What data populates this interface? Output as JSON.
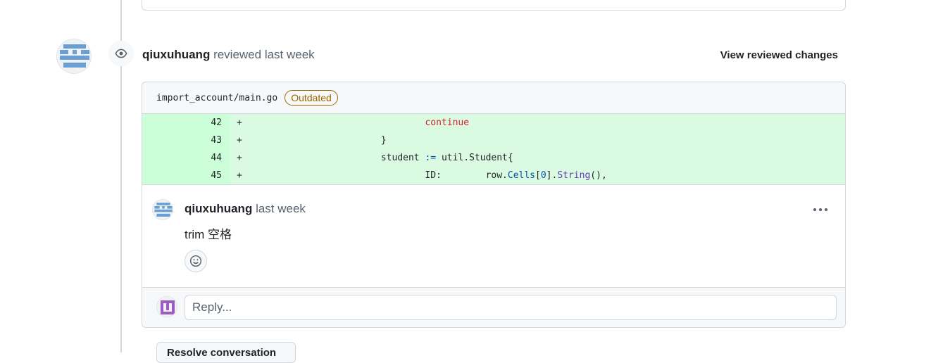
{
  "review": {
    "author": "qiuxuhuang",
    "action": "reviewed last week",
    "view_changes_label": "View reviewed changes"
  },
  "thread": {
    "file_path": "import_account/main.go",
    "badge": "Outdated",
    "diff_lines": [
      {
        "num": "42",
        "sign": "+"
      },
      {
        "num": "43",
        "sign": "+"
      },
      {
        "num": "44",
        "sign": "+"
      },
      {
        "num": "45",
        "sign": "+"
      }
    ],
    "code": {
      "l42": "continue",
      "l43": "}",
      "l44_var": "student",
      "l44_op": ":=",
      "l44_rest": "util.Student{",
      "l45_field": "ID:",
      "l45_row": "row.",
      "l45_cells": "Cells",
      "l45_idx_open": "[",
      "l45_idx": "0",
      "l45_idx_close": "].",
      "l45_string": "String",
      "l45_tail": "(),"
    },
    "comment": {
      "author": "qiuxuhuang",
      "time": "last week",
      "body": "trim 空格"
    },
    "reply_placeholder": "Reply..."
  },
  "resolve_button_label": "Resolve conversation",
  "colors": {
    "diff_add_bg": "#dafbe1",
    "diff_num_bg": "#ccffd8",
    "outdated": "#9a6700",
    "keyword": "#cf222e",
    "operator": "#0550ae"
  },
  "icons": [
    "eye-icon",
    "kebab-horizontal-icon",
    "smiley-icon"
  ]
}
